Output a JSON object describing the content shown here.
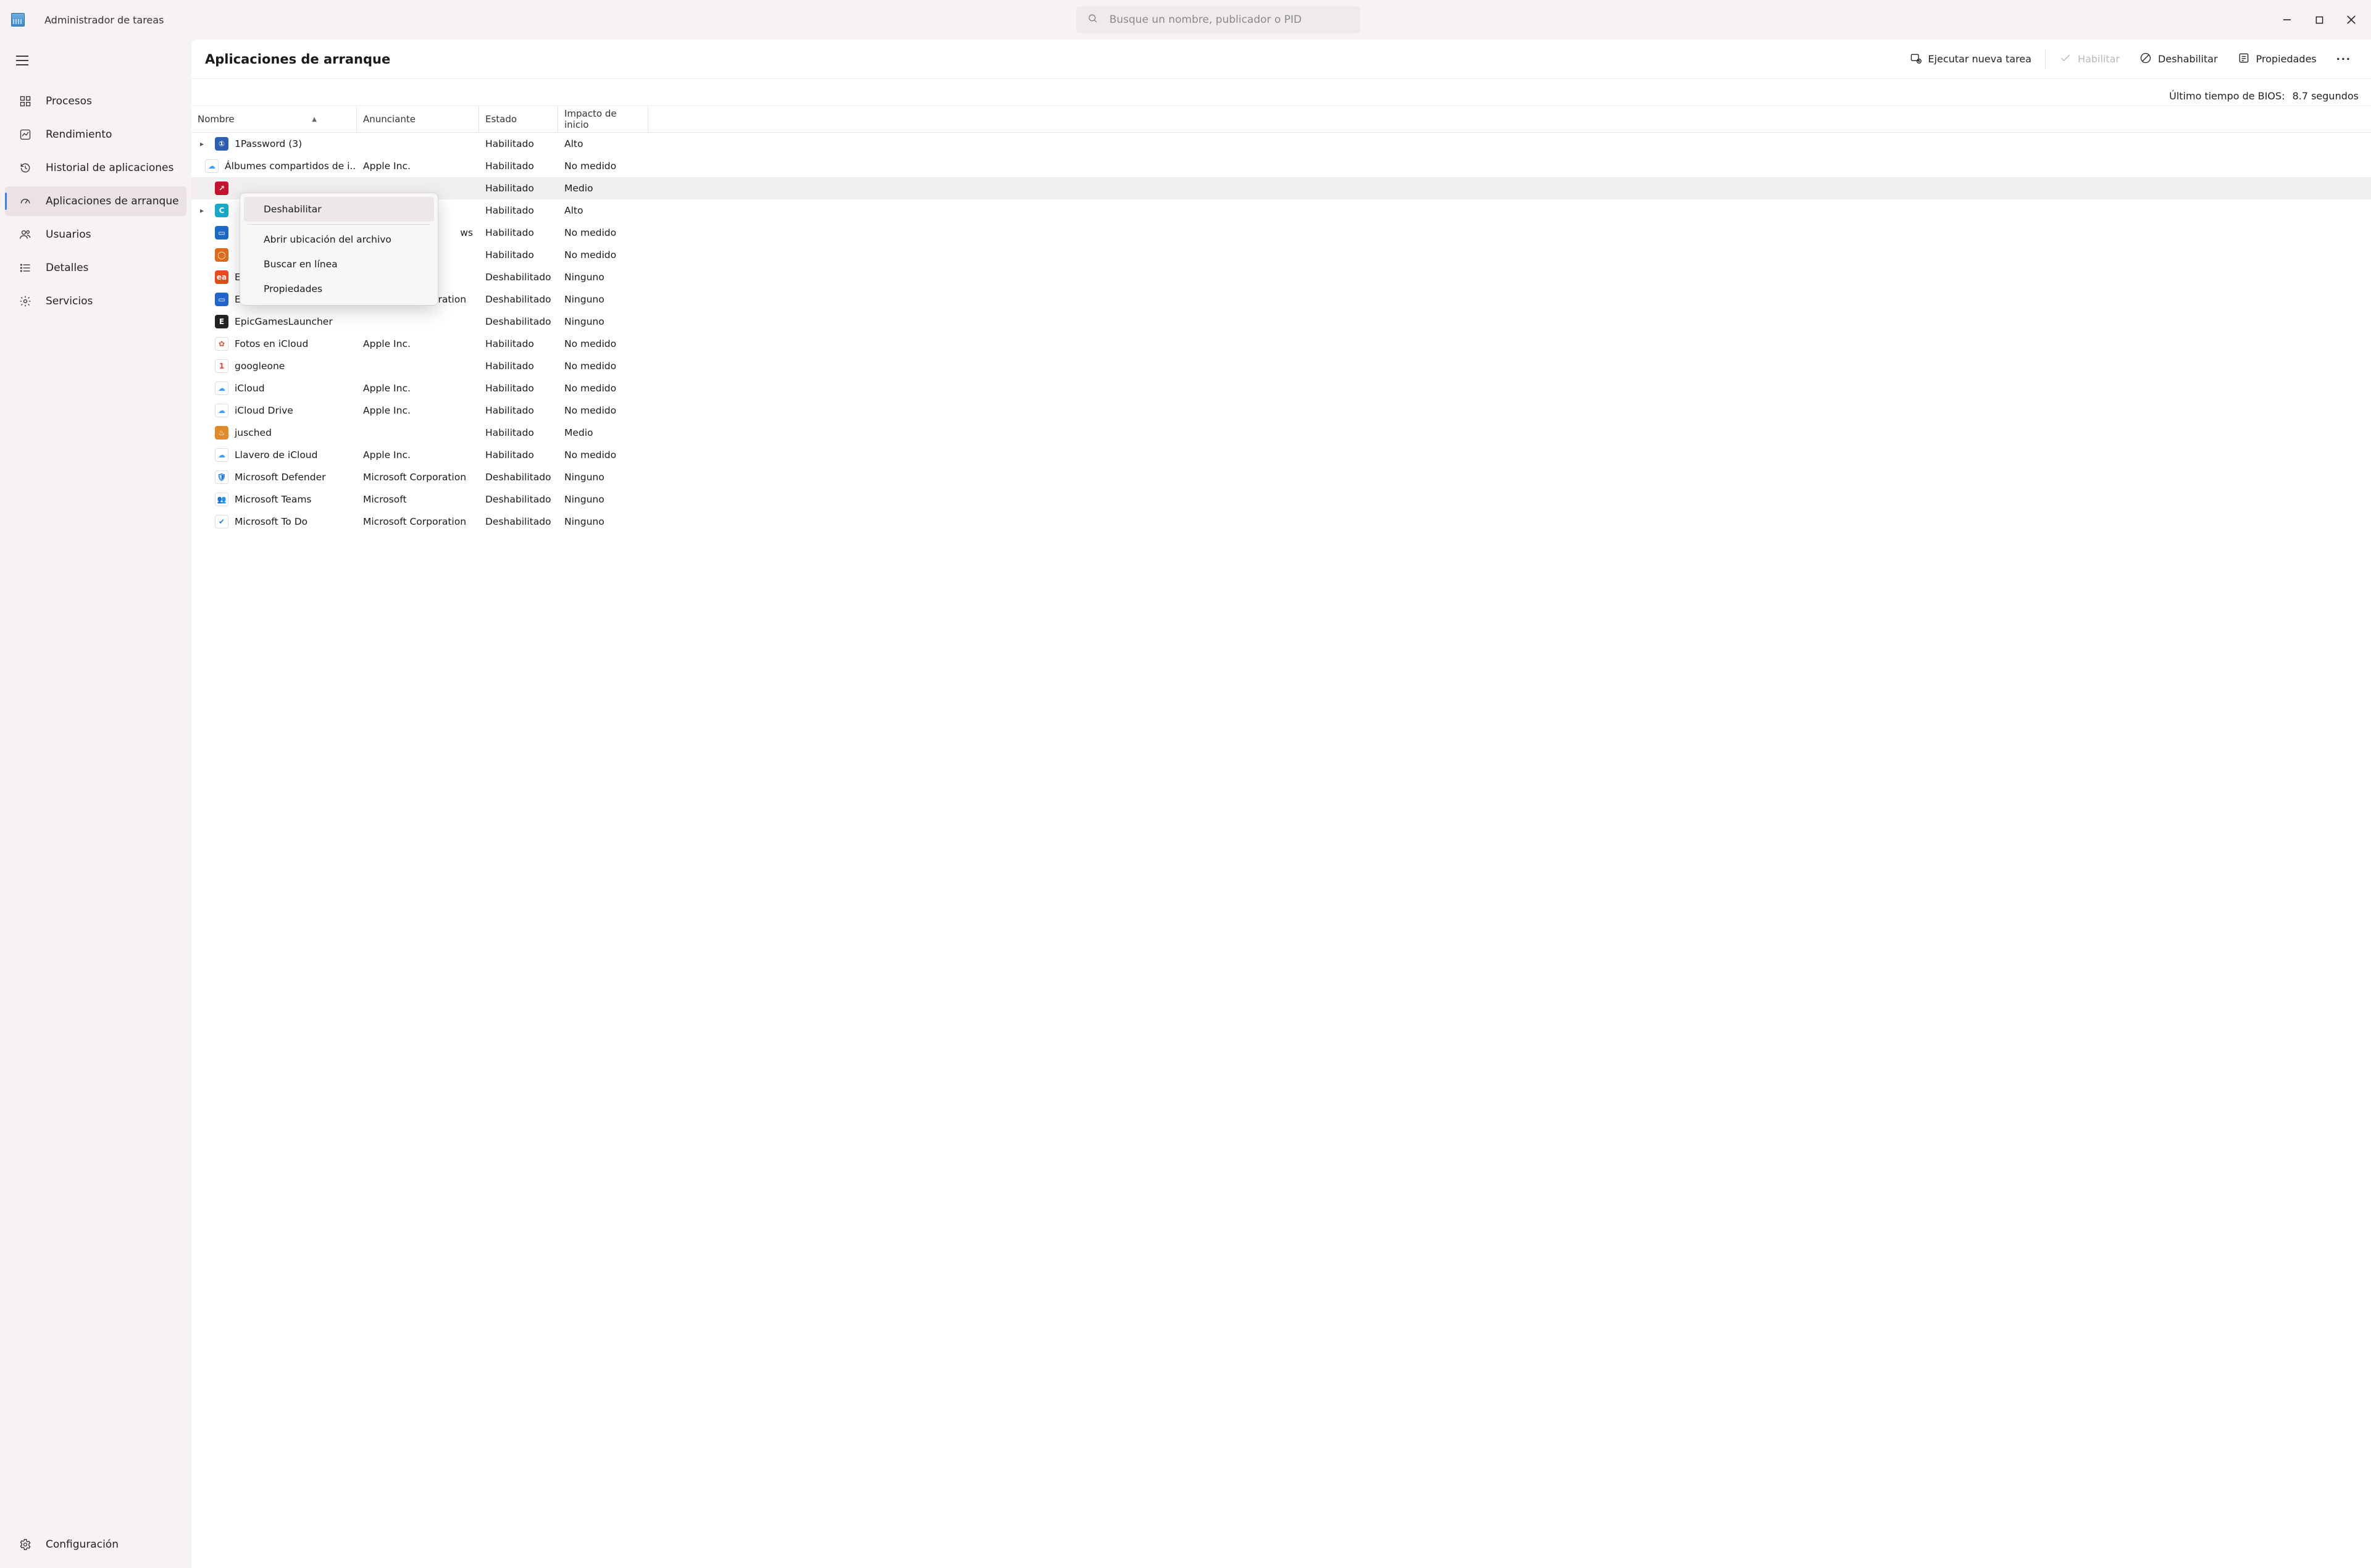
{
  "app_title": "Administrador de tareas",
  "search_placeholder": "Busque un nombre, publicador o PID",
  "sidebar": {
    "items": [
      {
        "label": "Procesos"
      },
      {
        "label": "Rendimiento"
      },
      {
        "label": "Historial de aplicaciones"
      },
      {
        "label": "Aplicaciones de arranque"
      },
      {
        "label": "Usuarios"
      },
      {
        "label": "Detalles"
      },
      {
        "label": "Servicios"
      }
    ],
    "settings_label": "Configuración"
  },
  "page": {
    "title": "Aplicaciones de arranque",
    "toolbar": {
      "run_task": "Ejecutar nueva tarea",
      "enable": "Habilitar",
      "disable": "Deshabilitar",
      "properties": "Propiedades"
    },
    "bios_label": "Último tiempo de BIOS:",
    "bios_value": "8.7 segundos",
    "columns": {
      "name": "Nombre",
      "publisher": "Anunciante",
      "status": "Estado",
      "impact": "Impacto de inicio"
    },
    "rows": [
      {
        "expand": true,
        "icon_bg": "#2c5fb3",
        "icon_txt": "①",
        "name": "1Password (3)",
        "publisher": "",
        "status": "Habilitado",
        "impact": "Alto"
      },
      {
        "expand": false,
        "icon_bg": "#ffffff",
        "icon_txt": "☁",
        "icon_fg": "#39a0ff",
        "name": "Álbumes compartidos de i...",
        "publisher": "Apple Inc.",
        "status": "Habilitado",
        "impact": "No medido"
      },
      {
        "expand": false,
        "icon_bg": "#c41230",
        "icon_txt": "↗",
        "name": "",
        "publisher": "",
        "status": "Habilitado",
        "impact": "Medio",
        "selected": true
      },
      {
        "expand": true,
        "icon_bg": "#17a9c9",
        "icon_txt": "C",
        "name": "",
        "publisher": "",
        "status": "Habilitado",
        "impact": "Alto"
      },
      {
        "expand": false,
        "icon_bg": "#1b6ac9",
        "icon_txt": "▭",
        "name": "",
        "publisher": "ws",
        "status": "Habilitado",
        "impact": "No medido",
        "pub_right": true
      },
      {
        "expand": false,
        "icon_bg": "#e06a1a",
        "icon_txt": "◯",
        "name": "",
        "publisher": "",
        "status": "Habilitado",
        "impact": "No medido"
      },
      {
        "expand": false,
        "icon_bg": "#e84a1c",
        "icon_txt": "ea",
        "name": "EALauncher",
        "publisher": "",
        "status": "Deshabilitado",
        "impact": "Ninguno"
      },
      {
        "expand": false,
        "icon_bg": "#2166cf",
        "icon_txt": "▭",
        "name": "Enlace Móvil",
        "publisher": "Microsoft Corporation",
        "status": "Deshabilitado",
        "impact": "Ninguno"
      },
      {
        "expand": false,
        "icon_bg": "#222222",
        "icon_txt": "E",
        "name": "EpicGamesLauncher",
        "publisher": "",
        "status": "Deshabilitado",
        "impact": "Ninguno"
      },
      {
        "expand": false,
        "icon_bg": "#ffffff",
        "icon_txt": "✿",
        "icon_fg": "#e8533a",
        "name": "Fotos en iCloud",
        "publisher": "Apple Inc.",
        "status": "Habilitado",
        "impact": "No medido"
      },
      {
        "expand": false,
        "icon_bg": "#ffffff",
        "icon_txt": "1",
        "icon_fg": "#ea4335",
        "name": "googleone",
        "publisher": "",
        "status": "Habilitado",
        "impact": "No medido"
      },
      {
        "expand": false,
        "icon_bg": "#ffffff",
        "icon_txt": "☁",
        "icon_fg": "#39a0ff",
        "name": "iCloud",
        "publisher": "Apple Inc.",
        "status": "Habilitado",
        "impact": "No medido"
      },
      {
        "expand": false,
        "icon_bg": "#ffffff",
        "icon_txt": "☁",
        "icon_fg": "#39a0ff",
        "name": "iCloud Drive",
        "publisher": "Apple Inc.",
        "status": "Habilitado",
        "impact": "No medido"
      },
      {
        "expand": false,
        "icon_bg": "#e08a2a",
        "icon_txt": "♨",
        "name": "jusched",
        "publisher": "",
        "status": "Habilitado",
        "impact": "Medio"
      },
      {
        "expand": false,
        "icon_bg": "#ffffff",
        "icon_txt": "☁",
        "icon_fg": "#39a0ff",
        "name": "Llavero de iCloud",
        "publisher": "Apple Inc.",
        "status": "Habilitado",
        "impact": "No medido"
      },
      {
        "expand": false,
        "icon_bg": "#ffffff",
        "icon_txt": "🛡",
        "icon_fg": "#1e78d6",
        "name": "Microsoft Defender",
        "publisher": "Microsoft Corporation",
        "status": "Deshabilitado",
        "impact": "Ninguno"
      },
      {
        "expand": false,
        "icon_bg": "#ffffff",
        "icon_txt": "👥",
        "icon_fg": "#5558c9",
        "name": "Microsoft Teams",
        "publisher": "Microsoft",
        "status": "Deshabilitado",
        "impact": "Ninguno"
      },
      {
        "expand": false,
        "icon_bg": "#ffffff",
        "icon_txt": "✔",
        "icon_fg": "#2f7de1",
        "name": "Microsoft To Do",
        "publisher": "Microsoft Corporation",
        "status": "Deshabilitado",
        "impact": "Ninguno"
      }
    ]
  },
  "context_menu": {
    "items": [
      {
        "label": "Deshabilitar",
        "highlight": true
      },
      {
        "sep": true
      },
      {
        "label": "Abrir ubicación del archivo"
      },
      {
        "label": "Buscar en línea"
      },
      {
        "label": "Propiedades"
      }
    ]
  }
}
